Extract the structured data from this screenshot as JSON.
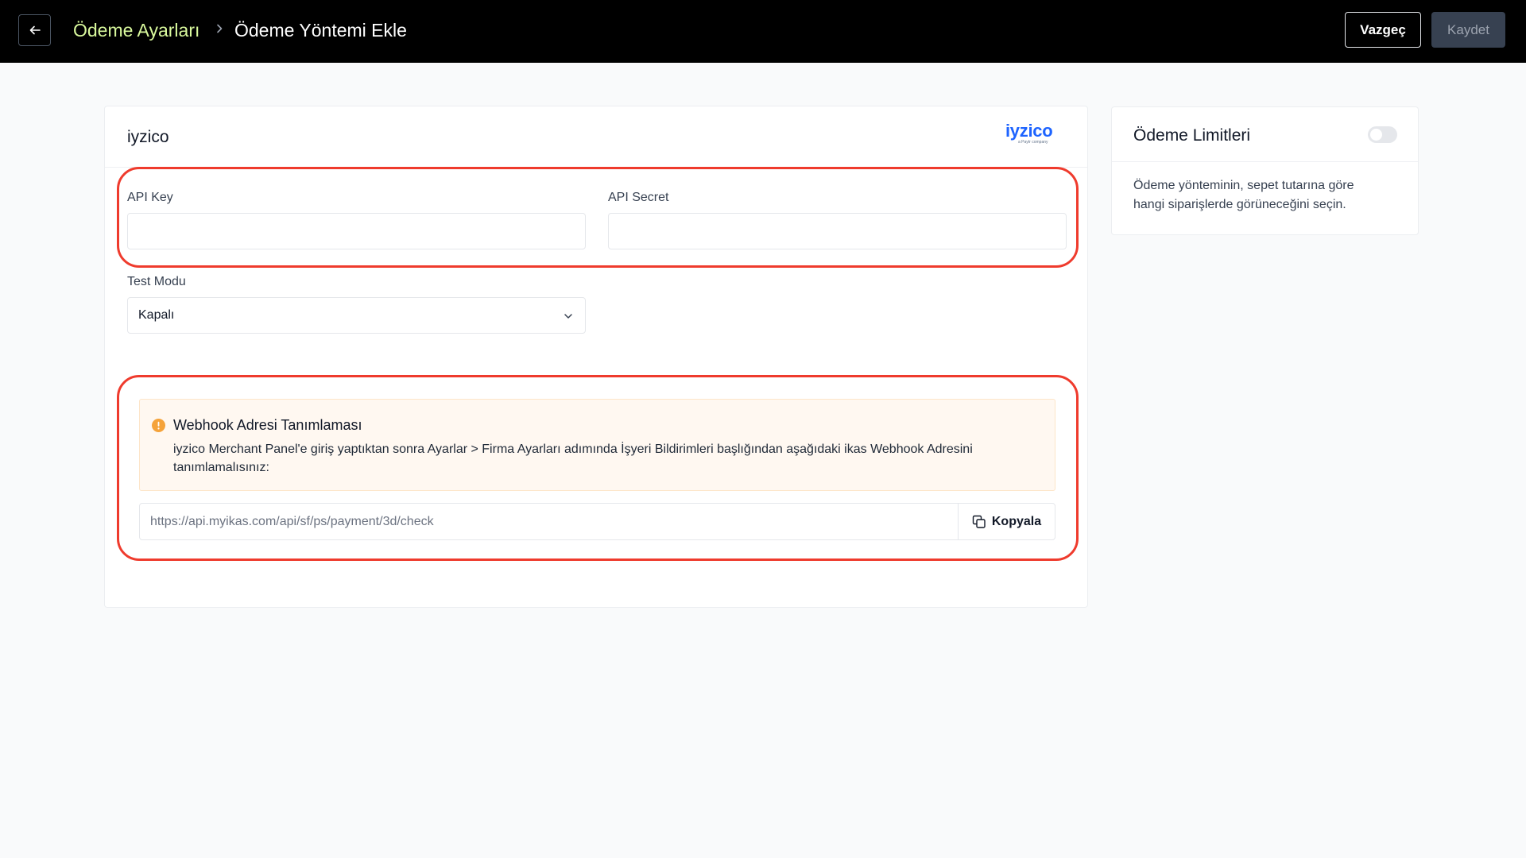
{
  "header": {
    "breadcrumb_parent": "Ödeme Ayarları",
    "title": "Ödeme Yöntemi Ekle",
    "cancel_label": "Vazgeç",
    "save_label": "Kaydet"
  },
  "provider": {
    "name": "iyzico",
    "logo_text": "iyzico",
    "logo_subtext": "a Paytr company"
  },
  "form": {
    "api_key_label": "API Key",
    "api_key_value": "",
    "api_secret_label": "API Secret",
    "api_secret_value": "",
    "test_mode_label": "Test Modu",
    "test_mode_value": "Kapalı"
  },
  "webhook": {
    "title": "Webhook Adresi Tanımlaması",
    "description": "iyzico Merchant Panel'e giriş yaptıktan sonra Ayarlar > Firma Ayarları adımında İşyeri Bildirimleri başlığından aşağıdaki ikas Webhook Adresini tanımlamalısınız:",
    "url": "https://api.myikas.com/api/sf/ps/payment/3d/check",
    "copy_label": "Kopyala"
  },
  "limits": {
    "title": "Ödeme Limitleri",
    "enabled": false,
    "description": "Ödeme yönteminin, sepet tutarına göre hangi siparişlerde görüneceğini seçin."
  },
  "colors": {
    "accent_breadcrumb": "#d9f99d",
    "highlight_outline": "#ef3b2d",
    "warning_bg": "#fff8f1",
    "warning_icon": "#f5a33a",
    "brand_iyzico": "#1e64ff"
  },
  "icons": {
    "back": "arrow-left-icon",
    "separator": "chevron-right-icon",
    "select": "chevron-down-icon",
    "warning": "exclamation-circle-icon",
    "copy": "copy-icon"
  }
}
